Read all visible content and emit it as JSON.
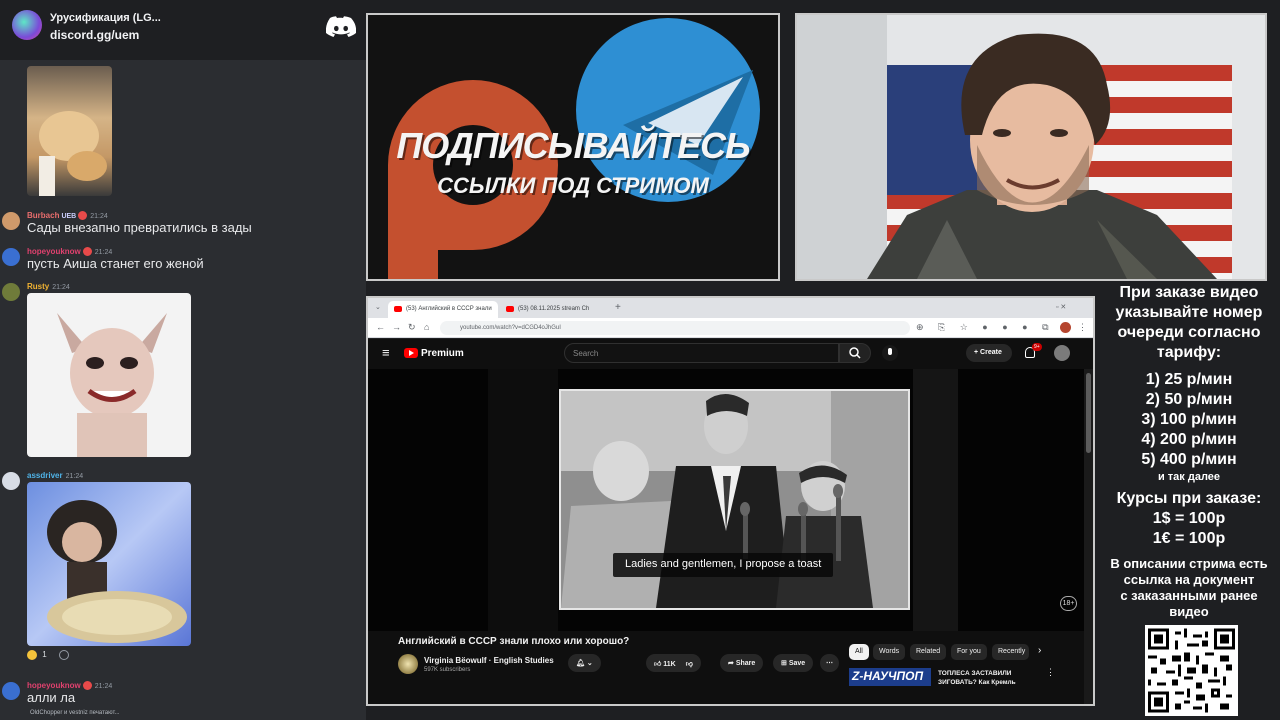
{
  "discord": {
    "server_name": "Урусификация (LG...",
    "invite": "discord.gg/uem",
    "messages": [
      {
        "user": "Burbach",
        "tag": "UEB",
        "time": "21:24",
        "text": "Сады внезапно превратились в зады",
        "color": "#e86d6d"
      },
      {
        "user": "hopeyouknow",
        "time": "21:24",
        "text": "пусть Аиша станет его женой",
        "color": "#e0416e"
      },
      {
        "user": "Rusty",
        "time": "21:24",
        "text": "",
        "color": "#f0b232"
      },
      {
        "user": "assdriver",
        "time": "21:24",
        "text": "",
        "color": "#4fb3e8"
      },
      {
        "user": "hopeyouknow",
        "time": "21:24",
        "text": "алли ла",
        "color": "#e0416e"
      }
    ],
    "reaction_count": "1",
    "typing": "OldChopper и vestniz печатают..."
  },
  "banner": {
    "headline": "ПОДПИСЫВАЙТЕСЬ",
    "subline": "ССЫЛКИ ПОД СТРИМОМ"
  },
  "browser": {
    "tabs": [
      "(53) Английский в СССР знали",
      "(53) 08.11.2025 stream Ch"
    ],
    "url": "youtube.com/watch?v=dCGD4oJhGuI",
    "yt_brand": "Premium",
    "search_placeholder": "Search",
    "create_label": "Create",
    "notif_count": "9+",
    "subtitle": "Ladies and gentlemen, I propose a toast",
    "age_badge": "18+",
    "video_title": "Английский в СССР знали плохо или хорошо?",
    "channel_name": "Virginia Bёowulf · English Studies",
    "channel_subs": "597K subscribers",
    "like_count": "11K",
    "share_label": "Share",
    "save_label": "Save",
    "chips": [
      "All",
      "Words",
      "Related",
      "For you",
      "Recently"
    ],
    "rec_thumb_text": "Z-НАУЧПОП",
    "rec_title": "ТОПЛЕСА ЗАСТАВИЛИ ЗИГОВАТЬ? Как Кремль"
  },
  "prices": {
    "header": [
      "При заказе видео",
      "указывайте номер",
      "очереди согласно",
      "тарифу:"
    ],
    "tiers": [
      "1) 25 р/мин",
      "2) 50 р/мин",
      "3) 100 р/мин",
      "4) 200 р/мин",
      "5) 400 р/мин"
    ],
    "etc": "и так далее",
    "rates_title": "Курсы при заказе:",
    "rates": [
      "1$ = 100р",
      "1€ = 100р"
    ],
    "description": [
      "В описании стрима есть",
      "ссылка на документ",
      "с заказанными ранее",
      "видео"
    ]
  }
}
